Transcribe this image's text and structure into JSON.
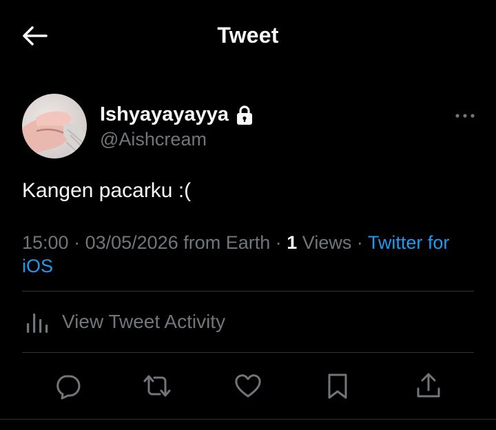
{
  "header": {
    "title": "Tweet",
    "back_icon": "arrow-left-icon"
  },
  "author": {
    "display_name": "Ishyayayayya",
    "handle": "@Aishcream",
    "protected_icon": "lock-icon",
    "more_icon": "more-horizontal-icon"
  },
  "tweet": {
    "text": "Kangen pacarku :("
  },
  "meta": {
    "time": "15:00",
    "sep1": " · ",
    "date": "03/05/2026",
    "location": " from Earth",
    "sep2": " · ",
    "views_count": "1",
    "views_label": " Views",
    "sep3": " · ",
    "source": "Twitter for iOS"
  },
  "activity": {
    "label": "View Tweet Activity",
    "icon": "bar-chart-icon"
  },
  "actions": [
    {
      "name": "reply",
      "icon": "reply-icon"
    },
    {
      "name": "retweet",
      "icon": "retweet-icon"
    },
    {
      "name": "like",
      "icon": "heart-icon"
    },
    {
      "name": "bookmark",
      "icon": "bookmark-icon"
    },
    {
      "name": "share",
      "icon": "share-icon"
    }
  ],
  "colors": {
    "background": "#000000",
    "text_primary": "#f7f9f9",
    "text_secondary": "#71767b",
    "accent": "#1d9bf0",
    "divider": "#2f3336"
  }
}
